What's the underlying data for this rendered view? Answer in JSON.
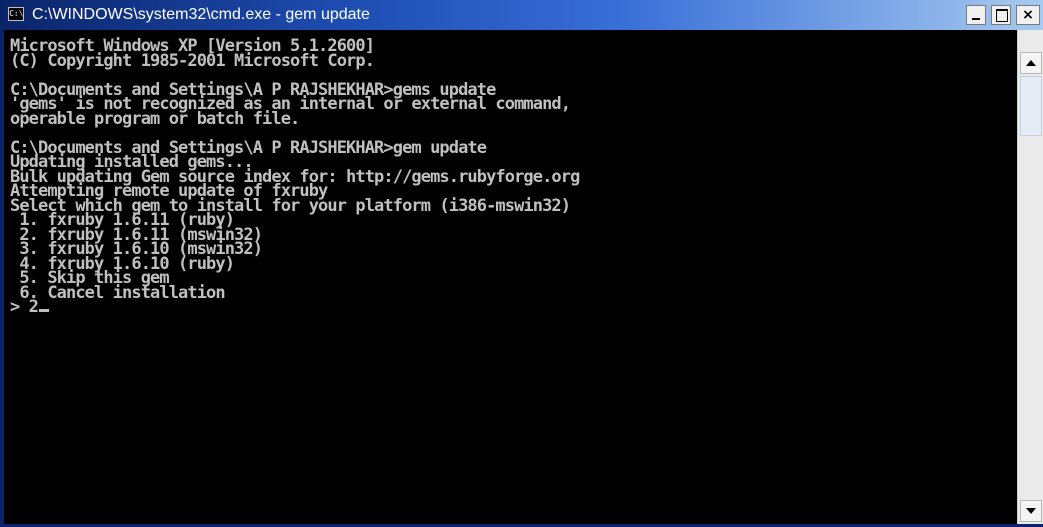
{
  "window": {
    "title": "C:\\WINDOWS\\system32\\cmd.exe - gem update",
    "icon_label": "C:\\",
    "icon_name": "console-app-icon",
    "controls": {
      "minimize_icon": "minimize-icon",
      "maximize_icon": "maximize-icon",
      "close_label": "×"
    },
    "colors": {
      "title_bar": "#0a246a",
      "console_bg": "#000000",
      "console_text": "#c0c0c0"
    }
  },
  "console": {
    "lines": [
      "Microsoft Windows XP [Version 5.1.2600]",
      "(C) Copyright 1985-2001 Microsoft Corp.",
      "",
      "C:\\Documents and Settings\\A P RAJSHEKHAR>gems update",
      "'gems' is not recognized as an internal or external command,",
      "operable program or batch file.",
      "",
      "C:\\Documents and Settings\\A P RAJSHEKHAR>gem update",
      "Updating installed gems...",
      "Bulk updating Gem source index for: http://gems.rubyforge.org",
      "Attempting remote update of fxruby",
      "Select which gem to install for your platform (i386-mswin32)",
      " 1. fxruby 1.6.11 (ruby)",
      " 2. fxruby 1.6.11 (mswin32)",
      " 3. fxruby 1.6.10 (mswin32)",
      " 4. fxruby 1.6.10 (ruby)",
      " 5. Skip this gem",
      " 6. Cancel installation"
    ],
    "prompt_line": "> 2"
  },
  "scrollbar": {
    "up_icon": "scroll-up-arrow-icon",
    "down_icon": "scroll-down-arrow-icon"
  }
}
